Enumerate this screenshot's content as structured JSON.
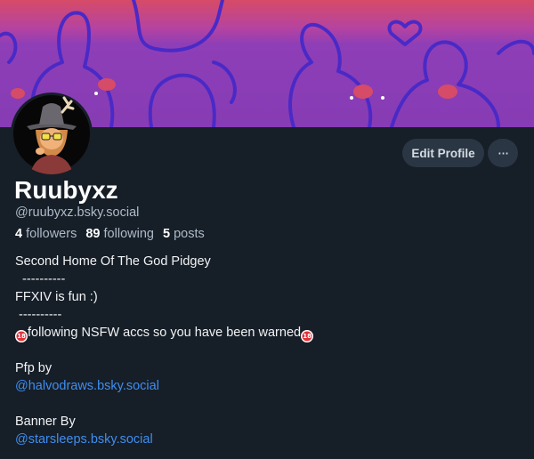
{
  "profile": {
    "display_name": "Ruubyxz",
    "handle": "@ruubyxz.bsky.social",
    "stats": {
      "followers_count": "4",
      "followers_label": "followers",
      "following_count": "89",
      "following_label": "following",
      "posts_count": "5",
      "posts_label": "posts"
    }
  },
  "actions": {
    "edit_label": "Edit Profile",
    "more_label": "···"
  },
  "bio": {
    "line1": "Second Home Of The God Pidgey",
    "line2": "  ----------",
    "line3": "FFXIV is fun :)",
    "line4": " ----------",
    "line5_badge": "18",
    "line5_text": "following NSFW accs so you have been warned",
    "line5_badge_end": "18",
    "line6": "Pfp by",
    "line7_link": "@halvodraws.bsky.social",
    "line8": "Banner By",
    "line9_link": "@starsleeps.bsky.social"
  },
  "colors": {
    "background": "#161e27",
    "banner_top": "#d94a6a",
    "banner_main": "#8a3fb5",
    "link": "#3f8ef0",
    "button_bg": "#2a3644"
  }
}
